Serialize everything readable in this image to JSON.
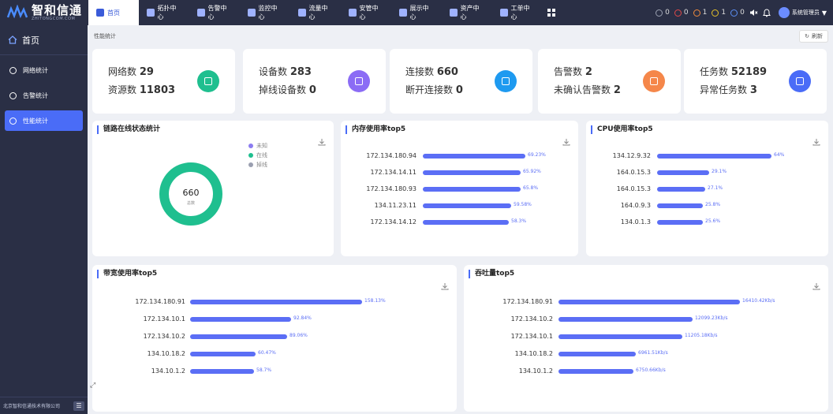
{
  "app": {
    "logo_name": "智和信通",
    "logo_sub": "ZHITONGCOM.COM"
  },
  "nav": [
    {
      "label": "首页",
      "icon": "home-icon",
      "active": true
    },
    {
      "label": "拓扑中心",
      "icon": "topology-icon"
    },
    {
      "label": "告警中心",
      "icon": "alarm-icon"
    },
    {
      "label": "监控中心",
      "icon": "monitor-icon"
    },
    {
      "label": "流量中心",
      "icon": "traffic-icon"
    },
    {
      "label": "安管中心",
      "icon": "security-icon"
    },
    {
      "label": "展示中心",
      "icon": "display-icon"
    },
    {
      "label": "资产中心",
      "icon": "asset-icon"
    },
    {
      "label": "工单中心",
      "icon": "ticket-icon"
    }
  ],
  "status_counts": [
    {
      "value": "0",
      "color": "#9aa0b0"
    },
    {
      "value": "0",
      "color": "#e04848"
    },
    {
      "value": "1",
      "color": "#f08a3c"
    },
    {
      "value": "1",
      "color": "#e6c229"
    },
    {
      "value": "0",
      "color": "#5b8ef5"
    }
  ],
  "user": {
    "name": "系统管理员"
  },
  "sidebar": {
    "home_label": "首页",
    "items": [
      {
        "label": "网络统计",
        "icon": "globe-icon"
      },
      {
        "label": "告警统计",
        "icon": "bell-icon"
      },
      {
        "label": "性能统计",
        "icon": "gauge-icon",
        "active": true
      }
    ],
    "footer": "北京智和信通技术有限公司"
  },
  "breadcrumb": "性能统计",
  "refresh_label": "刷新",
  "kpis": [
    {
      "l1": "网络数",
      "v1": "29",
      "l2": "资源数",
      "v2": "11803",
      "color": "#1fbf8f",
      "icon": "globe-icon"
    },
    {
      "l1": "设备数",
      "v1": "283",
      "l2": "掉线设备数",
      "v2": "0",
      "color": "#8b6cf5",
      "icon": "router-icon"
    },
    {
      "l1": "连接数",
      "v1": "660",
      "l2": "断开连接数",
      "v2": "0",
      "color": "#1e9af0",
      "icon": "share-icon"
    },
    {
      "l1": "告警数",
      "v1": "2",
      "l2": "未确认告警数",
      "v2": "2",
      "color": "#f5874a",
      "icon": "bell-icon"
    },
    {
      "l1": "任务数",
      "v1": "52189",
      "l2": "异常任务数",
      "v2": "3",
      "color": "#4a6cf7",
      "icon": "clipboard-icon"
    }
  ],
  "link_panel": {
    "title": "链路在线状态统计",
    "total": "660",
    "total_label": "总数",
    "legend": [
      {
        "label": "未知",
        "color": "#8b7cf0"
      },
      {
        "label": "在线",
        "color": "#1fbf8f"
      },
      {
        "label": "掉线",
        "color": "#9a9fb0"
      }
    ]
  },
  "mem_panel": {
    "title": "内存使用率top5",
    "rows": [
      {
        "label": "172.134.180.94",
        "value": 69.23,
        "text": "69.23%"
      },
      {
        "label": "172.134.14.11",
        "value": 65.92,
        "text": "65.92%"
      },
      {
        "label": "172.134.180.93",
        "value": 65.8,
        "text": "65.8%"
      },
      {
        "label": "134.11.23.11",
        "value": 59.58,
        "text": "59.58%"
      },
      {
        "label": "172.134.14.12",
        "value": 58.3,
        "text": "58.3%"
      }
    ]
  },
  "cpu_panel": {
    "title": "CPU使用率top5",
    "rows": [
      {
        "label": "134.12.9.32",
        "value": 64,
        "text": "64%"
      },
      {
        "label": "164.0.15.3",
        "value": 29.1,
        "text": "29.1%"
      },
      {
        "label": "164.0.15.3",
        "value": 27.1,
        "text": "27.1%"
      },
      {
        "label": "164.0.9.3",
        "value": 25.8,
        "text": "25.8%"
      },
      {
        "label": "134.0.1.3",
        "value": 25.6,
        "text": "25.6%"
      }
    ]
  },
  "bw_panel": {
    "title": "带宽使用率top5",
    "rows": [
      {
        "label": "172.134.180.91",
        "value": 158.13,
        "text": "158.13%"
      },
      {
        "label": "172.134.10.1",
        "value": 92.84,
        "text": "92.84%"
      },
      {
        "label": "172.134.10.2",
        "value": 89.06,
        "text": "89.06%"
      },
      {
        "label": "134.10.18.2",
        "value": 60.47,
        "text": "60.47%"
      },
      {
        "label": "134.10.1.2",
        "value": 58.7,
        "text": "58.7%"
      }
    ]
  },
  "tp_panel": {
    "title": "吞吐量top5",
    "rows": [
      {
        "label": "172.134.180.91",
        "value": 16410.42,
        "text": "16410.42Kb/s"
      },
      {
        "label": "172.134.10.2",
        "value": 12099.23,
        "text": "12099.23Kb/s"
      },
      {
        "label": "172.134.10.1",
        "value": 11205.18,
        "text": "11205.18Kb/s"
      },
      {
        "label": "134.10.18.2",
        "value": 6961.51,
        "text": "6961.51Kb/s"
      },
      {
        "label": "134.10.1.2",
        "value": 6750.66,
        "text": "6750.66Kb/s"
      }
    ]
  }
}
